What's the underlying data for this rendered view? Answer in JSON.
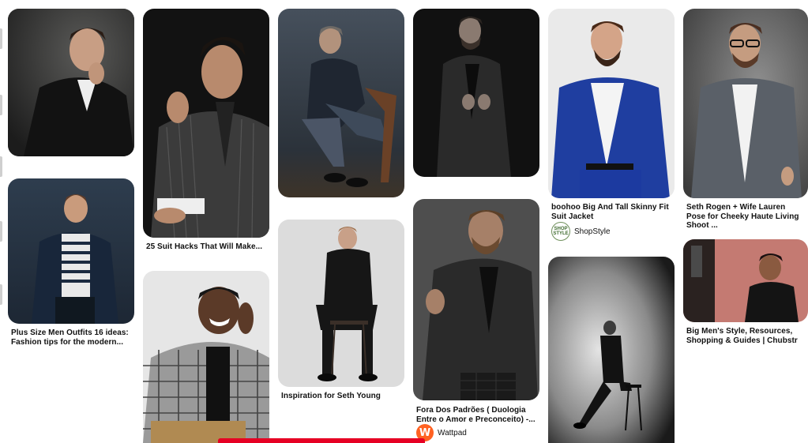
{
  "pins": [
    {
      "id": "p1",
      "image_alt": "man in black suit hand on chin"
    },
    {
      "id": "p2",
      "image_alt": "man in striped suit hand on face",
      "caption": "25 Suit Hacks That Will Make..."
    },
    {
      "id": "p3",
      "image_alt": "man seated on wooden chair"
    },
    {
      "id": "p4",
      "image_alt": "bearded man in black suit"
    },
    {
      "id": "p5",
      "image_alt": "man in blue suit",
      "caption": "boohoo Big And Tall Skinny Fit Suit Jacket",
      "source": "ShopStyle"
    },
    {
      "id": "p6",
      "image_alt": "man with glasses in grey blazer",
      "caption": "Seth Rogen + Wife Lauren Pose for Cheeky Haute Living Shoot ..."
    },
    {
      "id": "p7",
      "image_alt": "man in navy blazer striped shirt",
      "caption": "Plus Size Men Outfits 16 ideas: Fashion tips for the modern..."
    },
    {
      "id": "p8",
      "image_alt": "smiling man in plaid jacket"
    },
    {
      "id": "p9",
      "image_alt": "man sitting on stool",
      "caption": "Inspiration for Seth Young"
    },
    {
      "id": "p10",
      "image_alt": "man in black suit close up",
      "caption": "Fora Dos Padrões ( Duologia Entre o Amor e Preconceito) -...",
      "source": "Wattpad"
    },
    {
      "id": "p11",
      "image_alt": "man on stool black and white"
    },
    {
      "id": "p12",
      "image_alt": "man in black against pink wall",
      "caption": "Big Men's Style, Resources, Shopping & Guides | Chubstr"
    }
  ],
  "sources": {
    "shopstyle_logo_text": "SHOP STYLE",
    "wattpad_logo_text": "W"
  },
  "colors": {
    "accent": "#e60023",
    "wattpad": "#ff6122"
  }
}
